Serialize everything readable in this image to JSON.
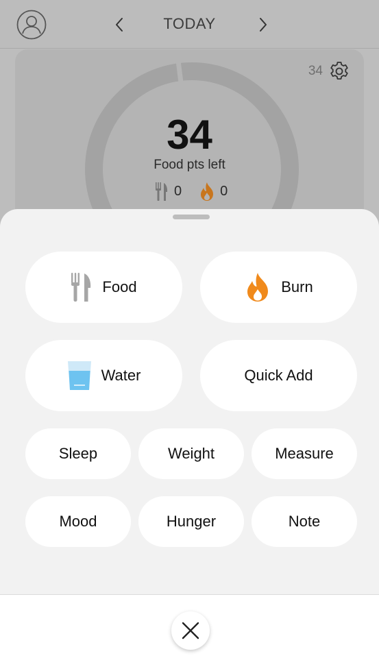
{
  "header": {
    "title": "TODAY",
    "avatar_icon": "user-avatar-icon",
    "prev_icon": "chevron-left-icon",
    "next_icon": "chevron-right-icon"
  },
  "summary": {
    "weekly_points": "34",
    "settings_icon": "gear-icon",
    "points_left": "34",
    "points_label": "Food pts left",
    "food_count": "0",
    "burn_count": "0",
    "ring_progress": 0.98
  },
  "sheet": {
    "actions": {
      "food": {
        "label": "Food",
        "icon": "fork-knife-icon"
      },
      "burn": {
        "label": "Burn",
        "icon": "flame-icon"
      },
      "water": {
        "label": "Water",
        "icon": "water-glass-icon"
      },
      "quick_add": {
        "label": "Quick Add"
      },
      "sleep": {
        "label": "Sleep"
      },
      "weight": {
        "label": "Weight"
      },
      "measure": {
        "label": "Measure"
      },
      "mood": {
        "label": "Mood"
      },
      "hunger": {
        "label": "Hunger"
      },
      "note": {
        "label": "Note"
      }
    },
    "close_icon": "close-icon"
  },
  "colors": {
    "flame": "#f08a1c",
    "water": "#6ec3f0",
    "sheet_bg": "#f2f2f2",
    "button_bg": "#ffffff"
  }
}
